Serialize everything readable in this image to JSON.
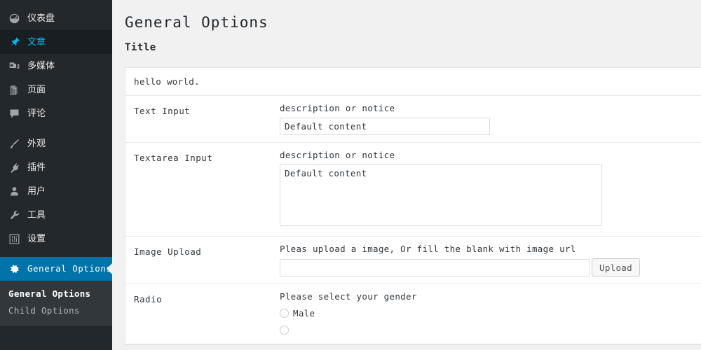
{
  "sidebar": {
    "items": [
      {
        "label": "仪表盘",
        "icon": "dashboard-icon",
        "state": "normal"
      },
      {
        "label": "文章",
        "icon": "pin-icon",
        "state": "active"
      },
      {
        "label": "多媒体",
        "icon": "media-icon",
        "state": "normal"
      },
      {
        "label": "页面",
        "icon": "pages-icon",
        "state": "normal"
      },
      {
        "label": "评论",
        "icon": "comments-icon",
        "state": "normal"
      },
      {
        "label": "外观",
        "icon": "appearance-icon",
        "state": "normal"
      },
      {
        "label": "插件",
        "icon": "plugins-icon",
        "state": "normal"
      },
      {
        "label": "用户",
        "icon": "users-icon",
        "state": "normal"
      },
      {
        "label": "工具",
        "icon": "tools-icon",
        "state": "normal"
      },
      {
        "label": "设置",
        "icon": "settings-icon",
        "state": "normal"
      }
    ],
    "current_item": {
      "label": "General Options",
      "icon": "gear-icon"
    },
    "submenu": [
      {
        "label": "General Options",
        "current": true
      },
      {
        "label": "Child Options",
        "current": false
      }
    ],
    "colors": {
      "background": "#23282d",
      "active_background": "#191e23",
      "current_background": "#0073aa",
      "submenu_background": "#32373c",
      "active_text": "#00b9eb"
    }
  },
  "content": {
    "page_title": "General Options",
    "section_title": "Title",
    "note": "hello world.",
    "rows": [
      {
        "label": "Text Input",
        "description": "description or notice",
        "value": "Default content"
      },
      {
        "label": "Textarea Input",
        "description": "description or notice",
        "value": "Default content"
      },
      {
        "label": "Image Upload",
        "description": "Pleas upload a image, Or fill the blank with image url",
        "value": "",
        "button_label": "Upload"
      },
      {
        "label": "Radio",
        "description": "Please select your gender",
        "options": [
          {
            "label": "Male",
            "checked": false
          },
          {
            "label": "",
            "checked": false
          }
        ]
      }
    ]
  }
}
